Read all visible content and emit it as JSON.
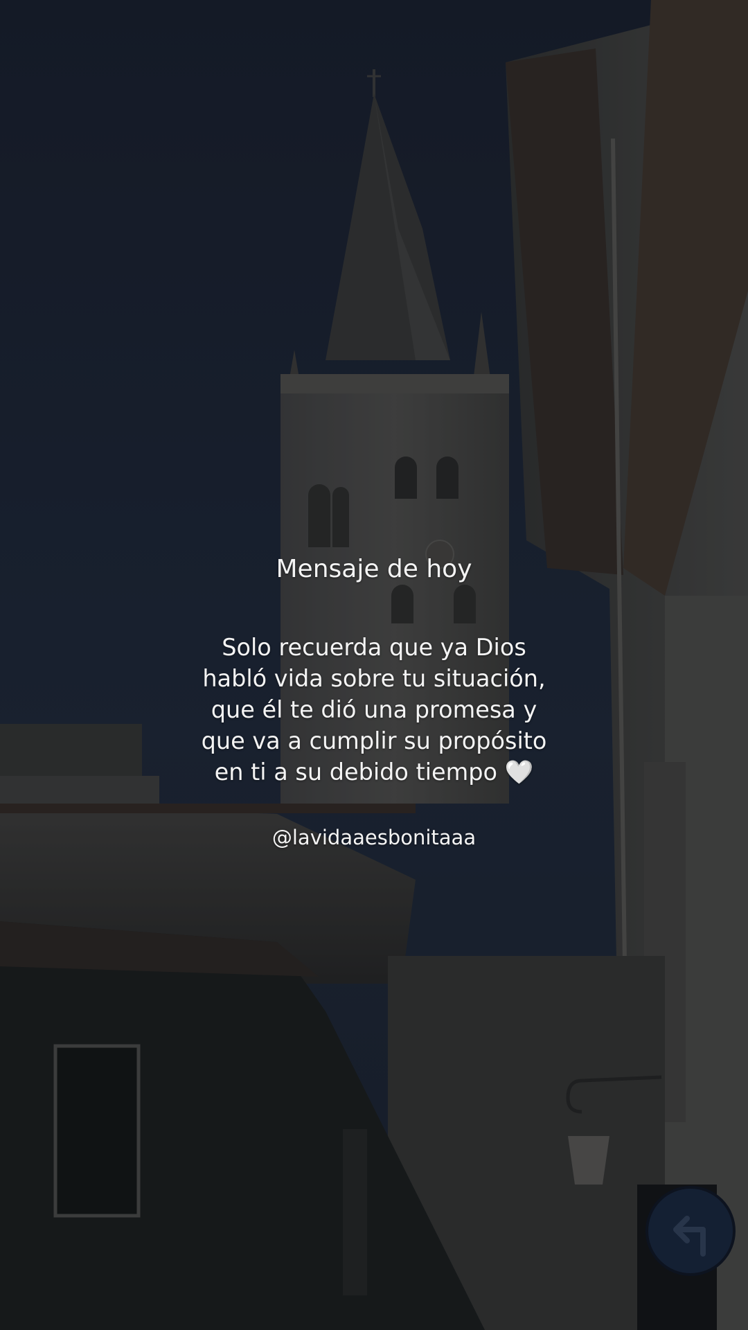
{
  "post": {
    "title": "Mensaje de hoy",
    "message": "Solo recuerda que ya Dios habló vida sobre tu situación, que él te dió una promesa y que va a cumplir su propósito en ti a su debido tiempo",
    "emoji": "🤍",
    "handle": "@lavidaaesbonitaaa"
  },
  "background": {
    "scene": "church-bell-tower-at-dusk",
    "sky_color": "#1e2636",
    "stone_color": "#5a5650"
  }
}
